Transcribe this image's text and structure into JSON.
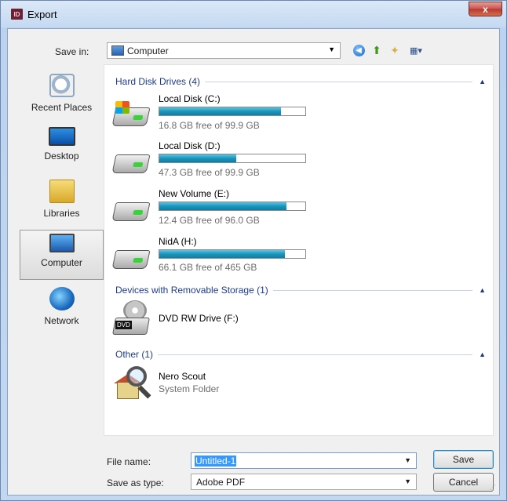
{
  "window": {
    "title": "Export",
    "app_icon_text": "ID",
    "close_glyph": "x"
  },
  "toolbar": {
    "save_in_label": "Save in:",
    "save_in_value": "Computer"
  },
  "places": [
    {
      "label": "Recent Places",
      "icon": "recent-places-icon"
    },
    {
      "label": "Desktop",
      "icon": "desktop-icon"
    },
    {
      "label": "Libraries",
      "icon": "libraries-icon"
    },
    {
      "label": "Computer",
      "icon": "computer-icon",
      "selected": true
    },
    {
      "label": "Network",
      "icon": "network-icon"
    }
  ],
  "groups": {
    "hard_disks": {
      "header": "Hard Disk Drives (4)",
      "drives": [
        {
          "name": "Local Disk (C:)",
          "free": "16.8 GB free of 99.9 GB",
          "used_fraction": 0.832
        },
        {
          "name": "Local Disk (D:)",
          "free": "47.3 GB free of 99.9 GB",
          "used_fraction": 0.527
        },
        {
          "name": "New Volume (E:)",
          "free": "12.4 GB free of 96.0 GB",
          "used_fraction": 0.871
        },
        {
          "name": "NidA (H:)",
          "free": "66.1 GB free of 465 GB",
          "used_fraction": 0.858
        }
      ]
    },
    "removable": {
      "header": "Devices with Removable Storage (1)",
      "items": [
        {
          "name": "DVD RW Drive (F:)",
          "badge": "DVD"
        }
      ]
    },
    "other": {
      "header": "Other (1)",
      "items": [
        {
          "name": "Nero Scout",
          "sub": "System Folder"
        }
      ]
    }
  },
  "form": {
    "file_name_label": "File name:",
    "file_name_value": "Untitled-1",
    "save_as_type_label": "Save as type:",
    "save_as_type_value": "Adobe PDF"
  },
  "buttons": {
    "save": "Save",
    "cancel": "Cancel"
  }
}
